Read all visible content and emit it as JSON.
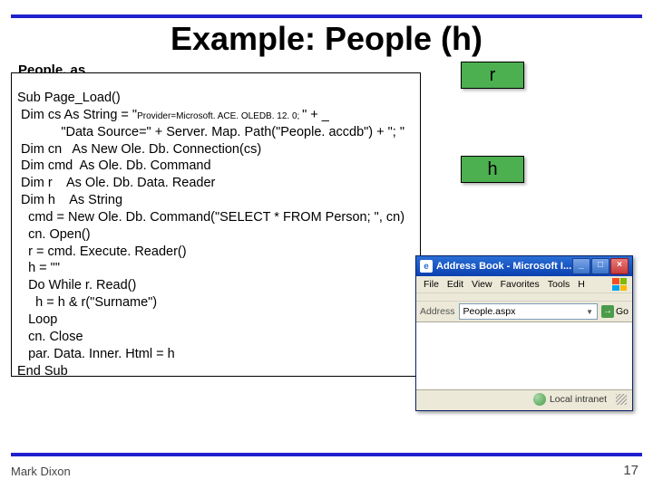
{
  "title": "Example: People (h)",
  "file_label": "People. as px",
  "boxes": {
    "r": "r",
    "h": "h"
  },
  "code": {
    "l1": "Sub Page_Load()",
    "l2a": " Dim cs As String = \"",
    "l2b": "Provider=Microsoft. ACE. OLEDB. 12. 0; ",
    "l2c": "\" + _",
    "l3": "            \"Data Source=\" + Server. Map. Path(\"People. accdb\") + \"; \"",
    "l4": " Dim cn   As New Ole. Db. Connection(cs)",
    "l5": " Dim cmd  As Ole. Db. Command",
    "l6": " Dim r    As Ole. Db. Data. Reader",
    "l7": " Dim h    As String",
    "l8": "   cmd = New Ole. Db. Command(\"SELECT * FROM Person; \", cn)",
    "l9": "   cn. Open()",
    "l10": "   r = cmd. Execute. Reader()",
    "l11": "   h = \"\"",
    "l12": "   Do While r. Read()",
    "l13": "     h = h & r(\"Surname\")",
    "l14": "   Loop",
    "l15": "   cn. Close",
    "l16": "   par. Data. Inner. Html = h",
    "l17": "End Sub"
  },
  "browser": {
    "title": "Address Book - Microsoft I...",
    "menus": [
      "File",
      "Edit",
      "View",
      "Favorites",
      "Tools",
      "H"
    ],
    "address_label": "Address",
    "address_value": "People.aspx",
    "go_label": "Go",
    "status": "Local intranet"
  },
  "footer": {
    "left": "Mark Dixon",
    "right": "17"
  }
}
